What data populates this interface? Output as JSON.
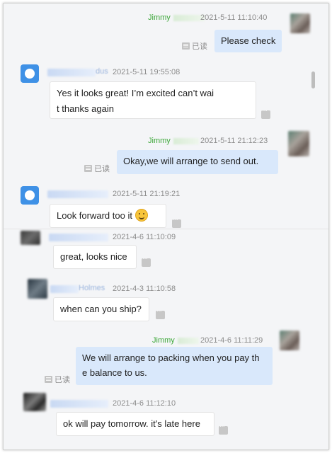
{
  "chat": {
    "m1": {
      "sender": "Jimmy",
      "time": "2021-5-11 11:10:40",
      "text": "Please check",
      "read_label": "已读"
    },
    "m2": {
      "sender_suffix": "dus",
      "time": "2021-5-11 19:55:08",
      "line1": "Yes it looks great! I’m excited can’t wai",
      "line2": "t thanks again"
    },
    "m3": {
      "sender": "Jimmy",
      "time": "2021-5-11 21:12:23",
      "text": "Okay,we will arrange to send out.",
      "read_label": "已读"
    },
    "m4": {
      "time": "2021-5-11 21:19:21",
      "text": "Look forward too it"
    },
    "m5": {
      "time": "2021-4-6 11:10:09",
      "text": "great, looks nice"
    },
    "m6": {
      "sender_suffix": "Holmes",
      "time": "2021-4-3 11:10:58",
      "text": "when can you ship?"
    },
    "m7": {
      "sender": "Jimmy",
      "time": "2021-4-6 11:11:29",
      "line1": "We will arrange to packing when you pay th",
      "line2": "e balance to us.",
      "read_label": "已读"
    },
    "m8": {
      "time": "2021-4-6 11:12:10",
      "text": "ok will pay tomorrow. it's late here"
    }
  },
  "icons": {
    "qq_avatar": "qq-penguin-avatar-icon",
    "more": "more-options-icon",
    "read": "read-receipt-icon",
    "emoji": "smiling-face-emoji"
  },
  "colors": {
    "outgoing_bubble": "#d9e8fb",
    "incoming_bubble": "#ffffff",
    "sender_name": "#3ea83a",
    "timestamp": "#8c8c8c",
    "qq_avatar": "#3f91e6"
  }
}
